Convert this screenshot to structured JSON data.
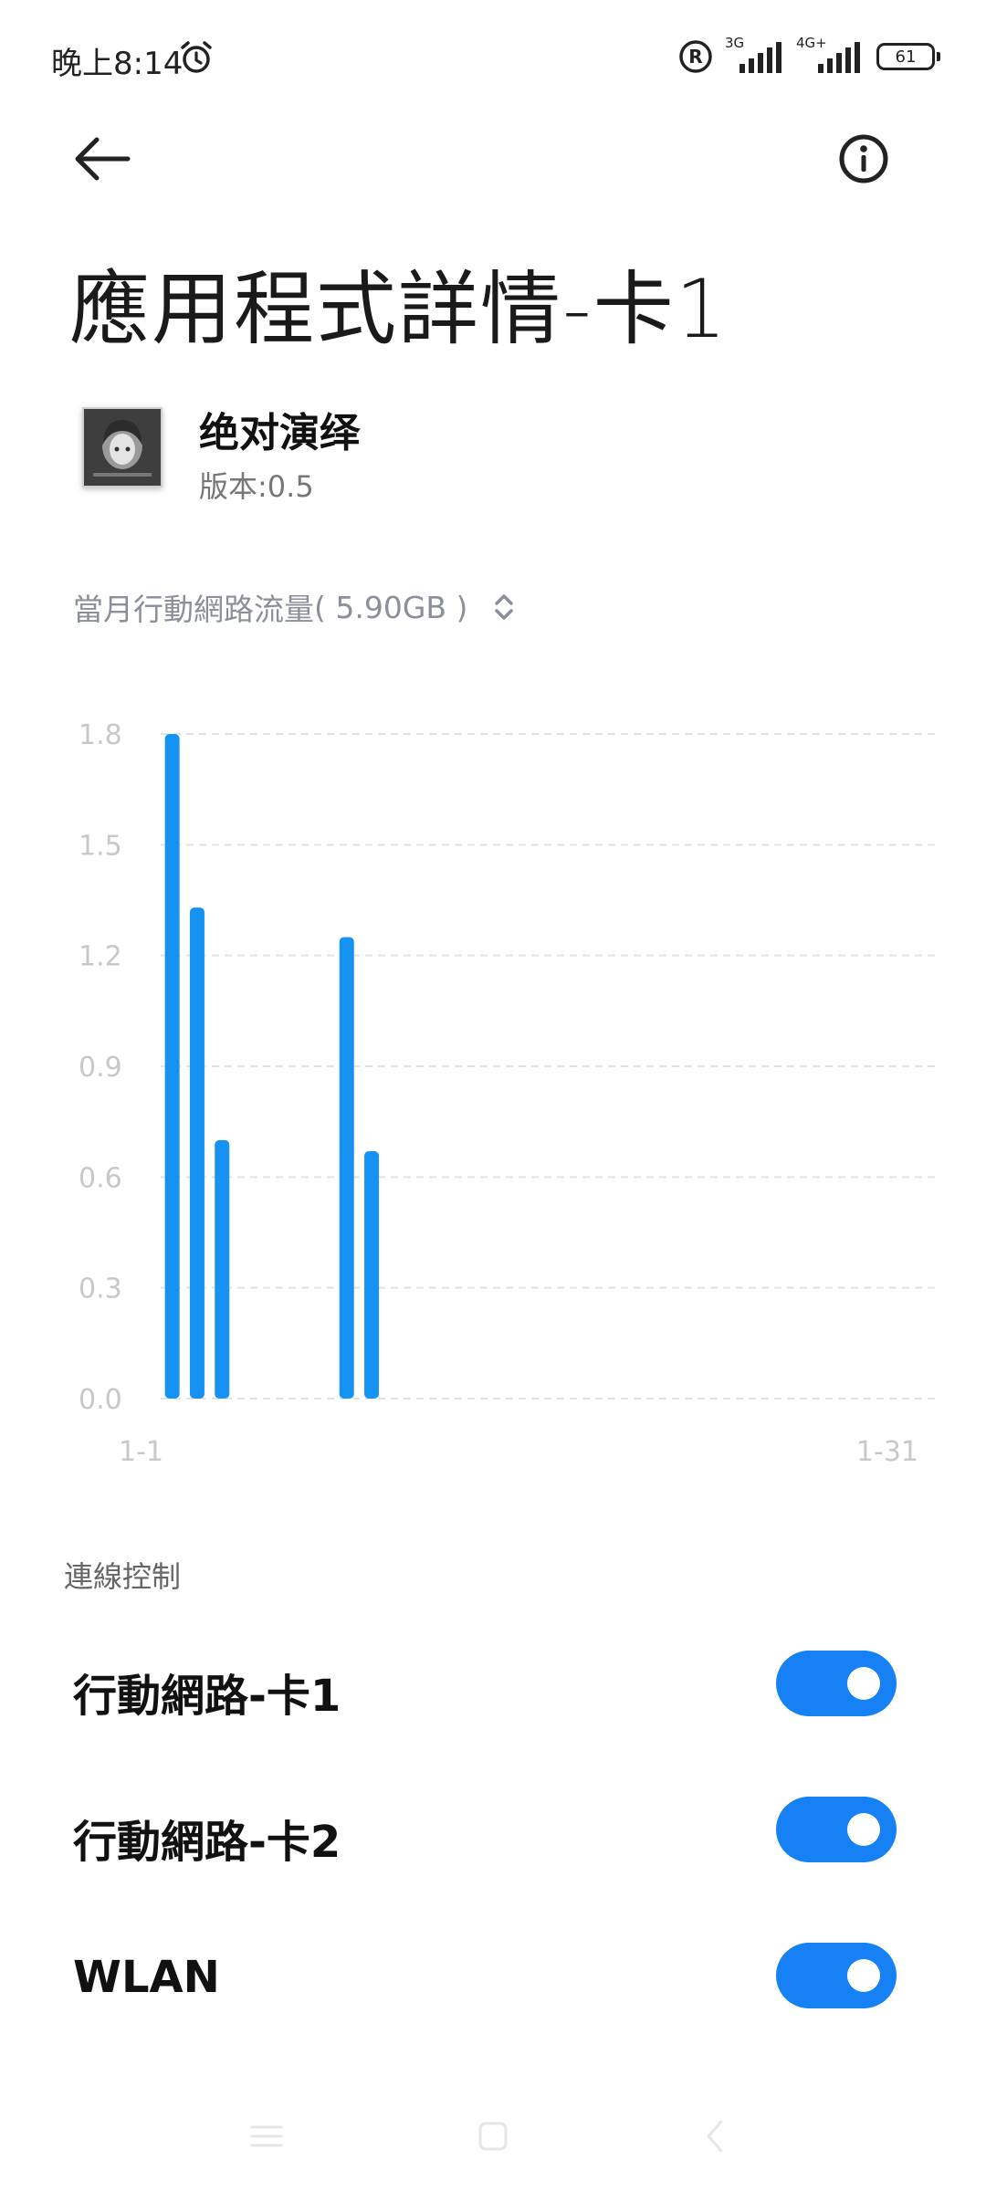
{
  "status_bar": {
    "time": "晚上8:14",
    "alarm_icon": "alarm-clock-icon",
    "reg_icon": "registered-icon",
    "sim1_label": "3G",
    "sim2_label": "4G+",
    "battery": "61"
  },
  "header": {
    "back_icon": "back-arrow-icon",
    "info_icon": "info-icon",
    "title": "應用程式詳情-卡1"
  },
  "app": {
    "name": "绝对演绎",
    "version": "版本:0.5"
  },
  "usage": {
    "label": "當月行動網路流量",
    "value": "( 5.90GB )",
    "selector_icon": "up-down-chevron-icon"
  },
  "chart_data": {
    "type": "bar",
    "x": [
      1,
      2,
      3,
      8,
      9
    ],
    "values": [
      1.8,
      1.33,
      0.7,
      1.25,
      0.67
    ],
    "x_range": [
      1,
      31
    ],
    "x_tick_labels": [
      "1-1",
      "1-31"
    ],
    "ylim": [
      0,
      1.8
    ],
    "y_ticks": [
      "0.0",
      "0.3",
      "0.6",
      "0.9",
      "1.2",
      "1.5",
      "1.8"
    ],
    "grid": true,
    "bar_color": "#1592f2",
    "grid_color": "#e2e2e2",
    "tick_color": "#c8c8c8"
  },
  "connection": {
    "section_label": "連線控制",
    "items": [
      {
        "label": "行動網路-卡1",
        "on": true
      },
      {
        "label": "行動網路-卡2",
        "on": true
      },
      {
        "label": "WLAN",
        "on": true
      }
    ],
    "toggle_color": "#1581f5"
  },
  "nav_bar": {
    "menu_icon": "menu-icon",
    "home_icon": "home-icon",
    "back_icon": "nav-back-icon"
  }
}
